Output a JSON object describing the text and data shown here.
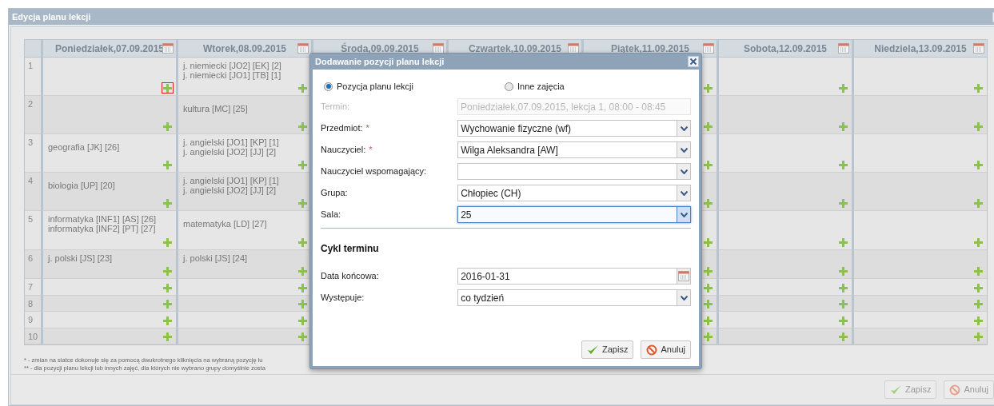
{
  "window": {
    "title": "Edycja planu lekcji"
  },
  "days": [
    {
      "label": "Poniedziałek,07.09.2015"
    },
    {
      "label": "Wtorek,08.09.2015"
    },
    {
      "label": "Środa,09.09.2015"
    },
    {
      "label": "Czwartek,10.09.2015"
    },
    {
      "label": "Piątek,11.09.2015"
    },
    {
      "label": "Sobota,12.09.2015"
    },
    {
      "label": "Niedziela,13.09.2015"
    }
  ],
  "rows": [
    {
      "number": "1",
      "cells": [
        {
          "selected": true
        },
        {
          "lessons": [
            "j. niemiecki [JO2] [EK] [2]",
            "j. niemiecki [JO1] [TB] [1]"
          ],
          "selected": false
        },
        {
          "selected": false
        },
        {
          "selected": false
        },
        {
          "selected": false
        }
      ]
    },
    {
      "number": "2",
      "cells": [
        {
          "selected": false
        },
        {
          "lessons": [
            "kultura [MC] [25]"
          ],
          "selected": false
        },
        {
          "selected": false
        },
        {
          "selected": false
        },
        {
          "selected": false
        }
      ]
    },
    {
      "number": "3",
      "cells": [
        {
          "lessons": [
            "geografia [JK] [26]"
          ],
          "selected": false
        },
        {
          "lessons": [
            "j. angielski [JO1] [KP] [1]",
            "j. angielski [JO2] [JJ] [2]"
          ],
          "selected": false
        },
        {
          "selected": false
        },
        {
          "selected": false
        },
        {
          "selected": false
        }
      ]
    },
    {
      "number": "4",
      "cells": [
        {
          "lessons": [
            "biologia [UP] [20]"
          ],
          "selected": false
        },
        {
          "lessons": [
            "j. angielski [JO1] [KP] [1]",
            "j. angielski [JO2] [JJ] [2]"
          ],
          "selected": false
        },
        {
          "selected": false
        },
        {
          "selected": false
        },
        {
          "selected": false
        }
      ]
    },
    {
      "number": "5",
      "cells": [
        {
          "lessons": [
            "informatyka [INF1] [AS] [26]",
            "informatyka [INF2] [PT] [27]"
          ],
          "selected": false
        },
        {
          "lessons": [
            "matematyka [LD] [27]"
          ],
          "selected": false
        },
        {
          "selected": false
        },
        {
          "selected": false
        },
        {
          "selected": false
        }
      ]
    },
    {
      "number": "6",
      "cells": [
        {
          "lessons": [
            "j. polski [JS] [23]"
          ],
          "selected": false
        },
        {
          "lessons": [
            "j. polski [JS] [24]"
          ],
          "selected": false
        },
        {
          "selected": false
        },
        {
          "selected": false
        },
        {
          "selected": false
        }
      ]
    },
    {
      "number": "7",
      "cells": [
        {
          "selected": false
        },
        {
          "selected": false
        },
        {
          "selected": false
        },
        {
          "selected": false
        },
        {
          "selected": false
        }
      ]
    },
    {
      "number": "8",
      "cells": [
        {
          "selected": false
        },
        {
          "selected": false
        },
        {
          "selected": false
        },
        {
          "selected": false
        },
        {
          "selected": false
        }
      ]
    },
    {
      "number": "9",
      "cells": [
        {
          "selected": false
        },
        {
          "selected": false
        },
        {
          "selected": false
        },
        {
          "selected": false
        },
        {
          "selected": false
        }
      ]
    },
    {
      "number": "10",
      "cells": [
        {
          "selected": false
        },
        {
          "selected": false
        },
        {
          "selected": false
        },
        {
          "selected": false
        },
        {
          "selected": false
        }
      ]
    }
  ],
  "footnotes": [
    "* - zmian na siatce dokonuje się za pomocą dwukrotnego kliknięcia na wybraną pozycję lu",
    "** - dla pozycji planu lekcji lub innych zajęć, dla których nie wybrano grupy domyślnie zosta"
  ],
  "buttons": [
    {
      "kind": "save",
      "label": "Zapisz"
    },
    {
      "kind": "cancel",
      "label": "Anuluj"
    }
  ],
  "dialog": {
    "title": "Dodawanie pozycji planu lekcji",
    "radios": [
      {
        "label": "Pozycja planu lekcji",
        "selected": true
      },
      {
        "label": "Inne zajęcia",
        "selected": false
      }
    ],
    "fields": [
      {
        "kind": "readonly",
        "label": "Termin:",
        "value": "Poniedziałek,07.09.2015, lekcja 1, 08:00 - 08:45"
      },
      {
        "kind": "select",
        "label": "Przedmiot:",
        "required_mark": "*",
        "value": "Wychowanie fizyczne (wf)",
        "focused": false
      },
      {
        "kind": "select",
        "label": "Nauczyciel:",
        "required_mark": "*",
        "value": "Wilga Aleksandra [AW]",
        "focused": false
      },
      {
        "kind": "select",
        "label": "Nauczyciel wspomagający:",
        "focused": false
      },
      {
        "kind": "select",
        "label": "Grupa:",
        "value": "Chłopiec (CH)",
        "focused": false
      },
      {
        "kind": "select",
        "label": "Sala:",
        "value": "25",
        "focused": true
      }
    ],
    "section": "Cykl terminu",
    "cycle_fields": [
      {
        "kind": "date",
        "label": "Data końcowa:",
        "value": "2016-01-31",
        "focused": false
      },
      {
        "kind": "select",
        "label": "Występuje:",
        "value": "co tydzień",
        "focused": false
      }
    ],
    "buttons": [
      {
        "kind": "save",
        "label": "Zapisz"
      },
      {
        "kind": "cancel",
        "label": "Anuluj"
      }
    ]
  }
}
